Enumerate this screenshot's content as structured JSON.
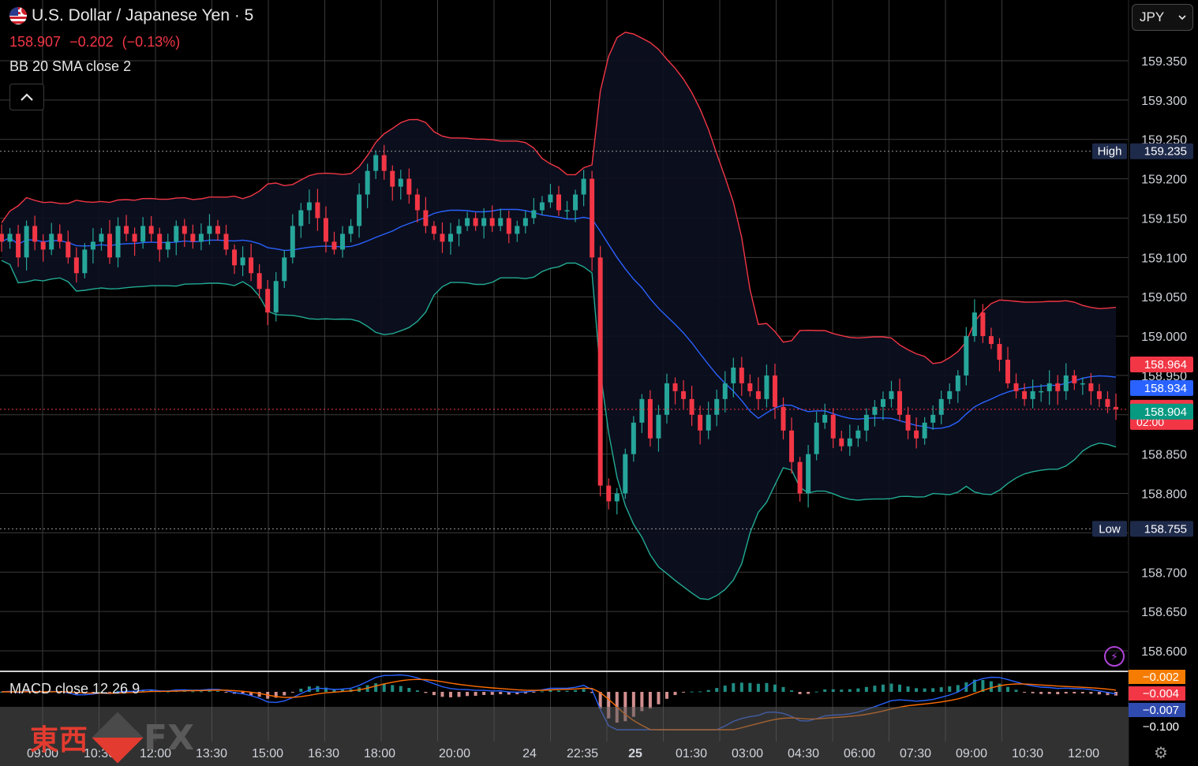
{
  "header": {
    "title": "U.S. Dollar / Japanese Yen · 5",
    "price": "158.907",
    "change": "−0.202",
    "change_pct": "(−0.13%)",
    "indicator": "BB 20 SMA close 2"
  },
  "macd": {
    "label": "MACD close 12 26 9"
  },
  "currency_select": {
    "value": "JPY",
    "icon": "chevron-down-icon"
  },
  "icons": {
    "collapse": "chevron-up-icon",
    "bolt": "lightning-icon",
    "settings": "settings-icon"
  },
  "watermark": {
    "kanji": "東西",
    "fx": "FX"
  },
  "colors": {
    "up": "#26a69a",
    "down": "#f23645",
    "bb_upper": "#f23645",
    "bb_basis": "#2962ff",
    "bb_lower": "#22ab94",
    "macd": "#2962ff",
    "signal": "#ff6d00",
    "grid": "#3a3a3a"
  },
  "chart_data": {
    "type": "candlestick",
    "title": "U.S. Dollar / Japanese Yen · 5",
    "price_axis": {
      "ticks": [
        "159.350",
        "159.300",
        "159.250",
        "159.200",
        "159.150",
        "159.100",
        "159.050",
        "159.000",
        "158.950",
        "158.850",
        "158.800",
        "158.700",
        "158.650",
        "158.600"
      ],
      "ylim": [
        158.58,
        159.39
      ]
    },
    "time_axis": {
      "ticks": [
        "09:00",
        "10:30",
        "12:00",
        "13:30",
        "15:00",
        "16:30",
        "18:00",
        "20:00",
        "24",
        "22:35",
        "25",
        "01:30",
        "03:00",
        "04:30",
        "06:00",
        "07:30",
        "09:00",
        "10:30",
        "12:00"
      ],
      "bold": [
        "25"
      ]
    },
    "price_badges": [
      {
        "label": "High",
        "value": "159.235",
        "price": 159.235,
        "color": "#1e2a4a"
      },
      {
        "label": "Low",
        "value": "158.755",
        "price": 158.755,
        "color": "#1e2a4a"
      },
      {
        "value": "158.964",
        "price": 158.964,
        "color": "#f23645"
      },
      {
        "value": "158.934",
        "price": 158.934,
        "color": "#2962ff"
      },
      {
        "value": "158.907",
        "sub": "02:00",
        "price": 158.907,
        "color": "#f23645"
      },
      {
        "value": "158.904",
        "price": 158.904,
        "color": "#089981"
      }
    ],
    "macd_badges": [
      {
        "value": "−0.002",
        "color": "#f57c00"
      },
      {
        "value": "−0.004",
        "color": "#f23645"
      },
      {
        "value": "−0.007",
        "color": "#2f4bb0"
      },
      {
        "value": "−0.100",
        "color": "none"
      }
    ],
    "series": [
      {
        "name": "USDJPY",
        "closes": [
          159.12,
          159.13,
          159.1,
          159.14,
          159.12,
          159.11,
          159.13,
          159.12,
          159.1,
          159.08,
          159.11,
          159.12,
          159.13,
          159.1,
          159.14,
          159.13,
          159.12,
          159.14,
          159.13,
          159.11,
          159.12,
          159.14,
          159.13,
          159.12,
          159.13,
          159.14,
          159.13,
          159.11,
          159.09,
          159.1,
          159.08,
          159.06,
          159.03,
          159.07,
          159.1,
          159.14,
          159.16,
          159.17,
          159.15,
          159.12,
          159.11,
          159.13,
          159.14,
          159.18,
          159.21,
          159.23,
          159.21,
          159.19,
          159.2,
          159.18,
          159.16,
          159.14,
          159.13,
          159.12,
          159.13,
          159.14,
          159.15,
          159.14,
          159.15,
          159.14,
          159.15,
          159.13,
          159.14,
          159.15,
          159.16,
          159.17,
          159.18,
          159.16,
          159.16,
          159.18,
          159.2,
          159.1,
          158.81,
          158.79,
          158.8,
          158.85,
          158.89,
          158.92,
          158.87,
          158.9,
          158.94,
          158.93,
          158.92,
          158.9,
          158.88,
          158.9,
          158.92,
          158.94,
          158.96,
          158.94,
          158.93,
          158.92,
          158.95,
          158.91,
          158.88,
          158.84,
          158.8,
          158.85,
          158.89,
          158.9,
          158.87,
          158.86,
          158.87,
          158.88,
          158.9,
          158.91,
          158.92,
          158.93,
          158.9,
          158.88,
          158.87,
          158.89,
          158.9,
          158.92,
          158.93,
          158.95,
          159.0,
          159.03,
          159.0,
          158.99,
          158.97,
          158.94,
          158.93,
          158.92,
          158.93,
          158.93,
          158.94,
          158.93,
          158.95,
          158.94,
          158.94,
          158.93,
          158.92,
          158.91,
          158.907
        ]
      }
    ]
  }
}
